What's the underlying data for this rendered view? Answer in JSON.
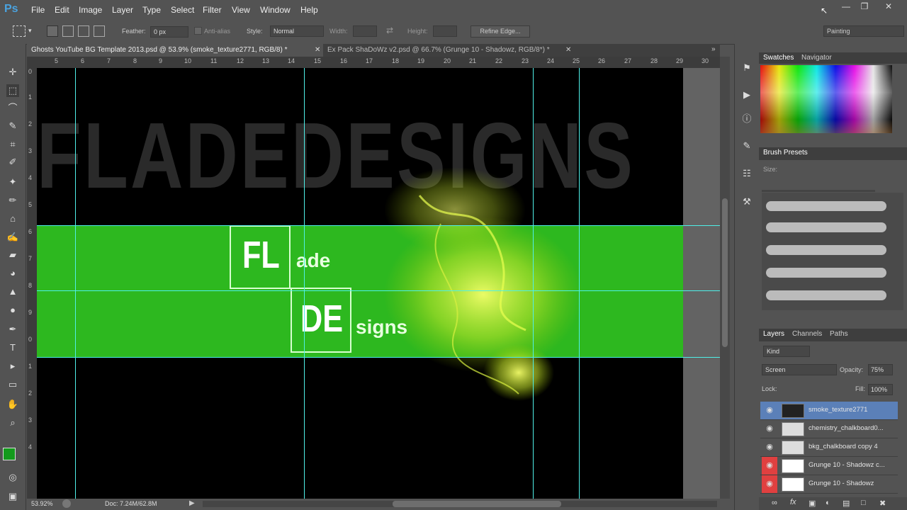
{
  "app": {
    "logo": "Ps"
  },
  "menu": [
    "File",
    "Edit",
    "Image",
    "Layer",
    "Type",
    "Select",
    "Filter",
    "View",
    "Window",
    "Help"
  ],
  "options": {
    "feather_label": "Feather:",
    "feather_value": "0 px",
    "antialias_label": "Anti-alias",
    "style_label": "Style:",
    "style_value": "Normal",
    "width_label": "Width:",
    "height_label": "Height:",
    "refine_label": "Refine Edge...",
    "workspace": "Painting"
  },
  "tabs": [
    {
      "label": "Ghosts YouTube BG Template 2013.psd @ 53.9% (smoke_texture2771, RGB/8) *",
      "active": true
    },
    {
      "label": "Ex Pack ShaDoWz v2.psd @ 66.7% (Grunge 10 - Shadowz, RGB/8*) *",
      "active": false
    }
  ],
  "ruler_h": [
    "5",
    "6",
    "7",
    "8",
    "9",
    "10",
    "11",
    "12",
    "13",
    "14",
    "15",
    "16",
    "17",
    "18",
    "19",
    "20",
    "21",
    "22",
    "23",
    "24",
    "25",
    "26",
    "27",
    "28",
    "29",
    "30"
  ],
  "ruler_v": [
    "0",
    "1",
    "2",
    "3",
    "4",
    "5",
    "6",
    "7",
    "8",
    "9",
    "0",
    "1",
    "2",
    "3",
    "4"
  ],
  "canvas": {
    "bigtext": "FLADEDESIGNS",
    "elem1_symbol": "FL",
    "elem1_word": "ade",
    "elem2_symbol": "DE",
    "elem2_word": "signs"
  },
  "status": {
    "zoom": "53.92%",
    "doc": "Doc: 7.24M/62.8M"
  },
  "swatches_panel": {
    "tab1": "Swatches",
    "tab2": "Navigator"
  },
  "brush_panel": {
    "title": "Brush Presets",
    "size_label": "Size:"
  },
  "layers_panel": {
    "tabs": [
      "Layers",
      "Channels",
      "Paths"
    ],
    "kind_label": "Kind",
    "blend_mode": "Screen",
    "opacity_label": "Opacity:",
    "opacity_value": "75%",
    "lock_label": "Lock:",
    "fill_label": "Fill:",
    "fill_value": "100%",
    "layers": [
      {
        "name": "smoke_texture2771",
        "selected": true,
        "eye": "normal"
      },
      {
        "name": "chemistry_chalkboard0...",
        "selected": false,
        "eye": "normal"
      },
      {
        "name": "bkg_chalkboard copy 4",
        "selected": false,
        "eye": "normal"
      },
      {
        "name": "Grunge 10 - Shadowz c...",
        "selected": false,
        "eye": "red"
      },
      {
        "name": "Grunge 10 - Shadowz",
        "selected": false,
        "eye": "red"
      }
    ]
  },
  "colors": {
    "guide": "#4ff0e8",
    "green_band": "#2db81f",
    "selection": "#5b80b8",
    "eye_red": "#e04040"
  }
}
